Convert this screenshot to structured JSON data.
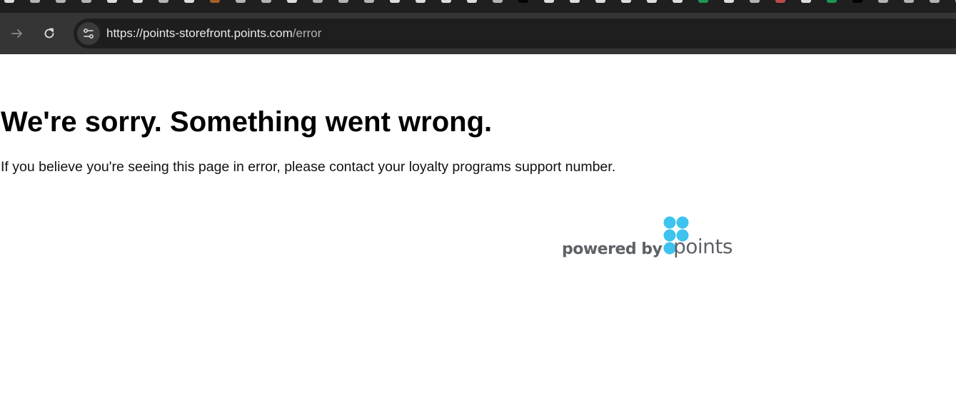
{
  "browser": {
    "url_host": "https://points-storefront.points.com",
    "url_path": "/error"
  },
  "page": {
    "heading": "We're sorry. Something went wrong.",
    "message": "If you believe you're seeing this page in error, please contact your loyalty programs support number."
  },
  "branding": {
    "powered_by": "powered by",
    "logo_text": "points",
    "logo_color": "#3ec3ee",
    "text_color": "#5e6166"
  },
  "icons": {
    "forward": "arrow-right-icon",
    "reload": "reload-icon",
    "site_info": "tune-icon"
  }
}
